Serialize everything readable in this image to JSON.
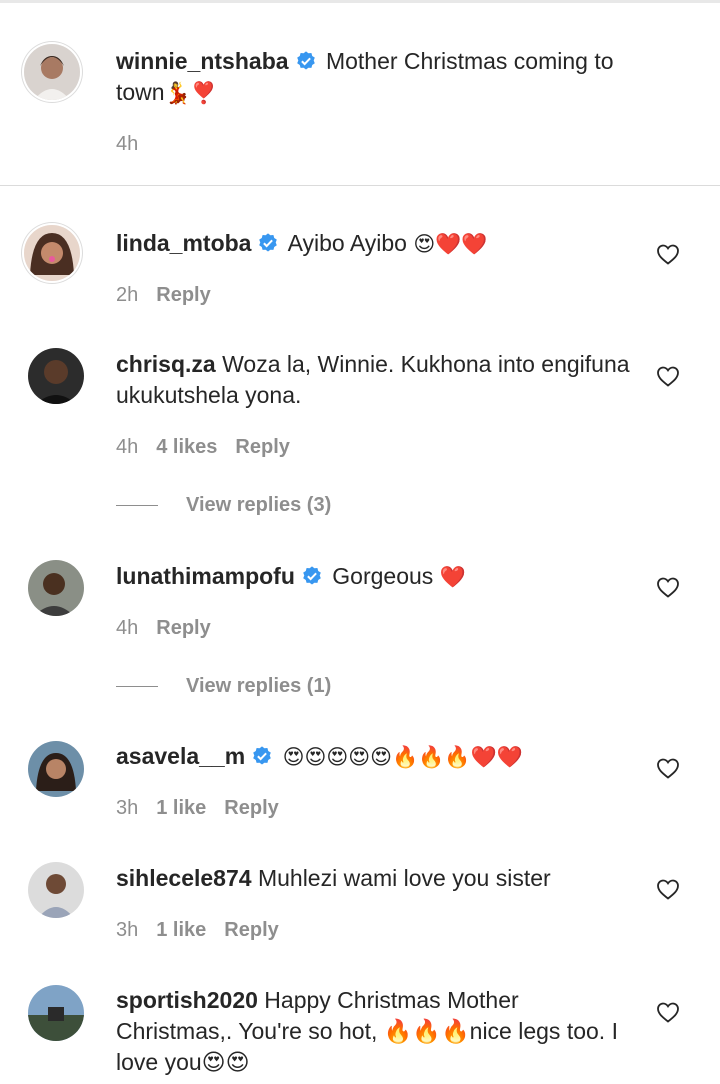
{
  "caption": {
    "username": "winnie_ntshaba",
    "verified": true,
    "text": "Mother Christmas coming to town",
    "emoji": "💃❣️",
    "time": "4h"
  },
  "comments": [
    {
      "username": "linda_mtoba",
      "verified": true,
      "text": "Ayibo Ayibo",
      "emoji": "😍❤️❤️",
      "time": "2h",
      "likes": "",
      "reply": "Reply",
      "view_replies": ""
    },
    {
      "username": "chrisq.za",
      "verified": false,
      "text": "Woza la, Winnie. Kukhona into engifuna ukukutshela yona.",
      "emoji": "",
      "time": "4h",
      "likes": "4 likes",
      "reply": "Reply",
      "view_replies": "View replies (3)"
    },
    {
      "username": "lunathimampofu",
      "verified": true,
      "text": "Gorgeous",
      "emoji": "❤️",
      "time": "4h",
      "likes": "",
      "reply": "Reply",
      "view_replies": "View replies (1)"
    },
    {
      "username": "asavela__m",
      "verified": true,
      "text": "",
      "emoji": "😍😍😍😍😍🔥🔥🔥❤️❤️",
      "time": "3h",
      "likes": "1 like",
      "reply": "Reply",
      "view_replies": ""
    },
    {
      "username": "sihlecele874",
      "verified": false,
      "text": "Muhlezi wami love you sister",
      "emoji": "",
      "time": "3h",
      "likes": "1 like",
      "reply": "Reply",
      "view_replies": ""
    },
    {
      "username": "sportish2020",
      "verified": false,
      "text": "Happy Christmas Mother Christmas,. You're so hot, 🔥🔥🔥nice legs too. I love you😍😍",
      "emoji": "",
      "time": "",
      "likes": "",
      "reply": "",
      "view_replies": ""
    }
  ],
  "icons": {
    "verified": "verified-badge-icon",
    "like": "heart-outline-icon"
  },
  "colors": {
    "verified": "#3897f0",
    "muted": "#8e8e8e",
    "text": "#262626",
    "emoji_heart": "#e0102b"
  }
}
